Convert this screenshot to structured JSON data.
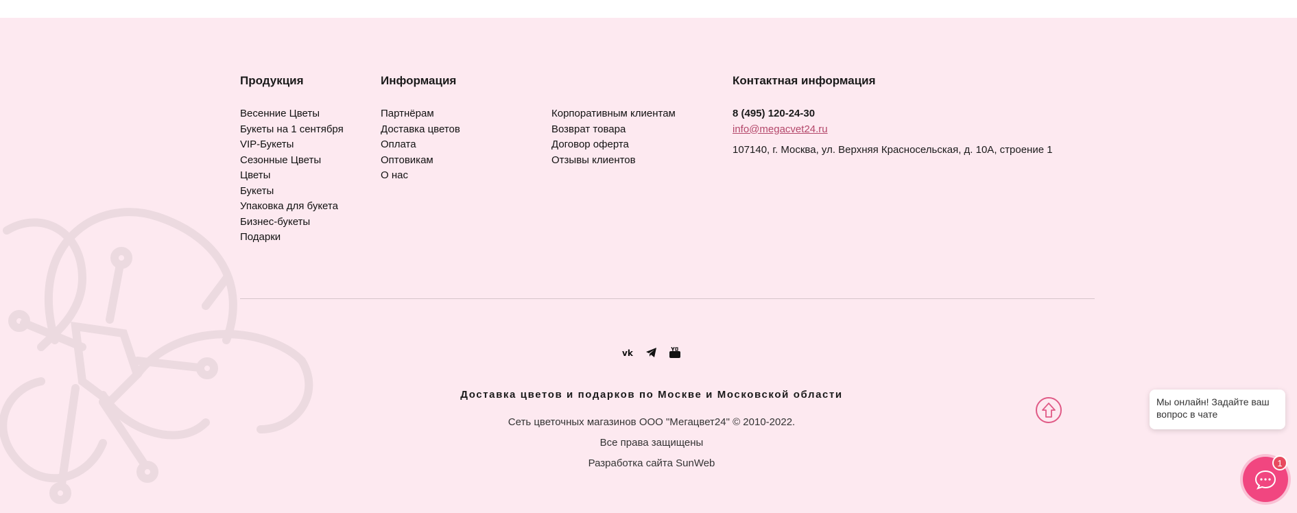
{
  "products": {
    "heading": "Продукция",
    "items": [
      "Весенние Цветы",
      "Букеты на 1 сентября",
      "VIP-Букеты",
      "Сезонные Цветы",
      "Цветы",
      "Букеты",
      "Упаковка для букета",
      "Бизнес-букеты",
      "Подарки"
    ]
  },
  "info": {
    "heading": "Информация",
    "items": [
      "Партнёрам",
      "Доставка цветов",
      "Оплата",
      "Оптовикам",
      "О нас"
    ],
    "items2": [
      "Корпоративным клиентам",
      "Возврат товара",
      "Договор оферта",
      "Отзывы клиентов"
    ]
  },
  "contact": {
    "heading": "Контактная информация",
    "phone": "8 (495) 120-24-30",
    "email": "info@megacvet24.ru",
    "address": "107140, г. Москва, ул. Верхняя Красносельская, д. 10А, строение 1"
  },
  "socials": [
    {
      "name": "vk",
      "icon": "vk-icon"
    },
    {
      "name": "telegram",
      "icon": "telegram-icon"
    },
    {
      "name": "youtube",
      "icon": "youtube-icon"
    }
  ],
  "tagline": "Доставка цветов и подарков по Москве и Московской области",
  "copyright": "Сеть цветочных магазинов ООО \"Мегацвет24\" © 2010-2022.",
  "rights": "Все права защищены",
  "dev_prefix": "Разработка сайта",
  "dev_link": "SunWeb",
  "chat": {
    "bubble_text": "Мы онлайн! Задайте ваш вопрос в чате",
    "badge": "1"
  },
  "colors": {
    "footer_bg": "#fde9f0",
    "accent": "#f14680",
    "email_link": "#b4476a"
  }
}
